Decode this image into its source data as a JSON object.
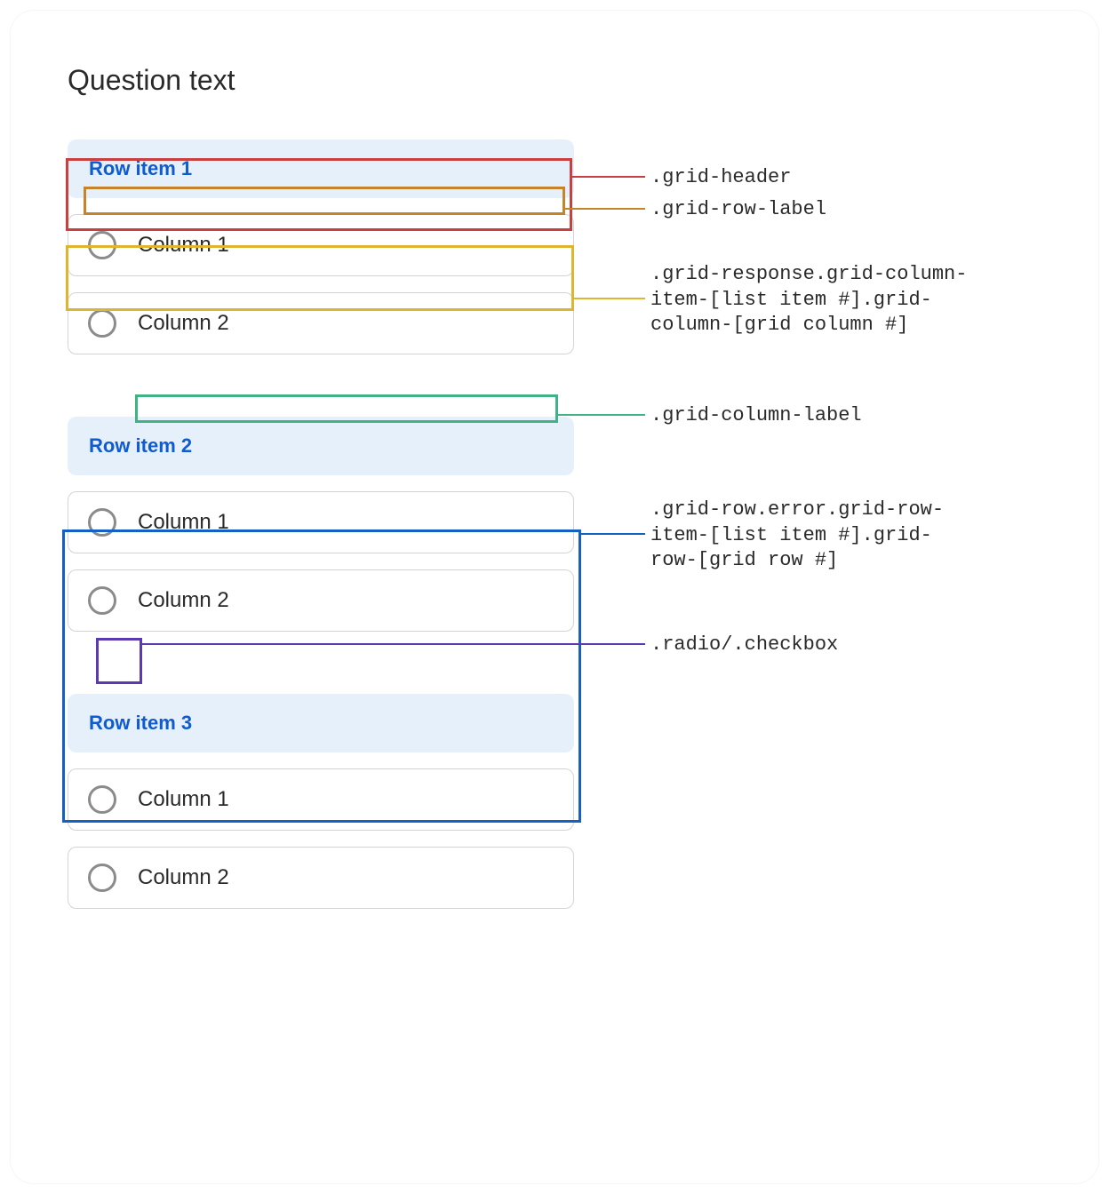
{
  "question_title": "Question text",
  "rows": [
    {
      "label": "Row item 1",
      "columns": [
        "Column 1",
        "Column 2"
      ]
    },
    {
      "label": "Row item 2",
      "columns": [
        "Column 1",
        "Column 2"
      ]
    },
    {
      "label": "Row item 3",
      "columns": [
        "Column 1",
        "Column 2"
      ]
    }
  ],
  "annotations": {
    "header": ".grid-header",
    "row_label": ".grid-row-label",
    "response": ".grid-response.grid-column-\nitem-[list item #].grid-\ncolumn-[grid column #]",
    "column_label": ".grid-column-label",
    "row_error": ".grid-row.error.grid-row-\nitem-[list item #].grid-\nrow-[grid row #]",
    "radio": ".radio/.checkbox"
  }
}
